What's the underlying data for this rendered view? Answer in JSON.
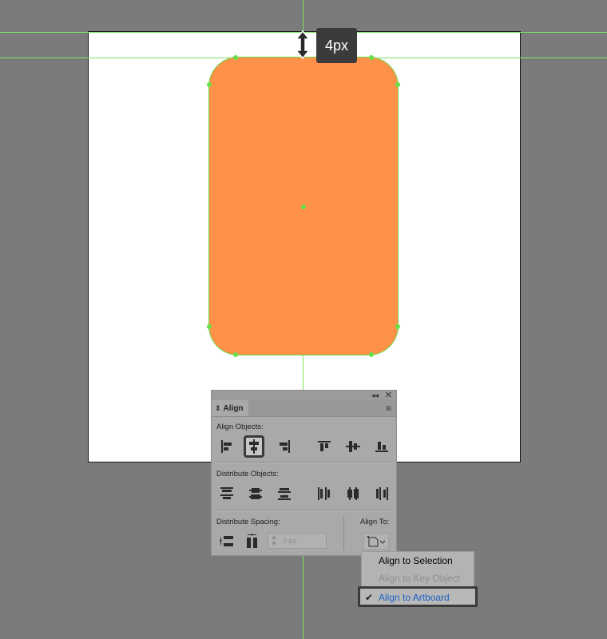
{
  "canvas": {
    "tooltip_text": "4px",
    "colors": {
      "background": "#7b7b7b",
      "artboard": "#ffffff",
      "shape_fill": "#ff9148",
      "guide": "#7de55f"
    }
  },
  "align_panel": {
    "tab_title": "Align",
    "collapse_glyph": "◂◂",
    "close_glyph": "✕",
    "menu_glyph": "≡",
    "sort_glyph": "⇕",
    "align_objects_label": "Align Objects:",
    "distribute_objects_label": "Distribute Objects:",
    "distribute_spacing_label": "Distribute Spacing:",
    "align_to_label": "Align To:",
    "spacing_value": "0 px",
    "align_objects_buttons": [
      "horizontal-align-left",
      "horizontal-align-center",
      "horizontal-align-right",
      "vertical-align-top",
      "vertical-align-center",
      "vertical-align-bottom"
    ],
    "active_button": "horizontal-align-center"
  },
  "align_to_menu": {
    "items": [
      {
        "label": "Align to Selection",
        "state": "enabled"
      },
      {
        "label": "Align to Key Object",
        "state": "disabled"
      },
      {
        "label": "Align to Artboard",
        "state": "checked"
      }
    ],
    "check_glyph": "✔",
    "accent": "#1e62c8"
  }
}
